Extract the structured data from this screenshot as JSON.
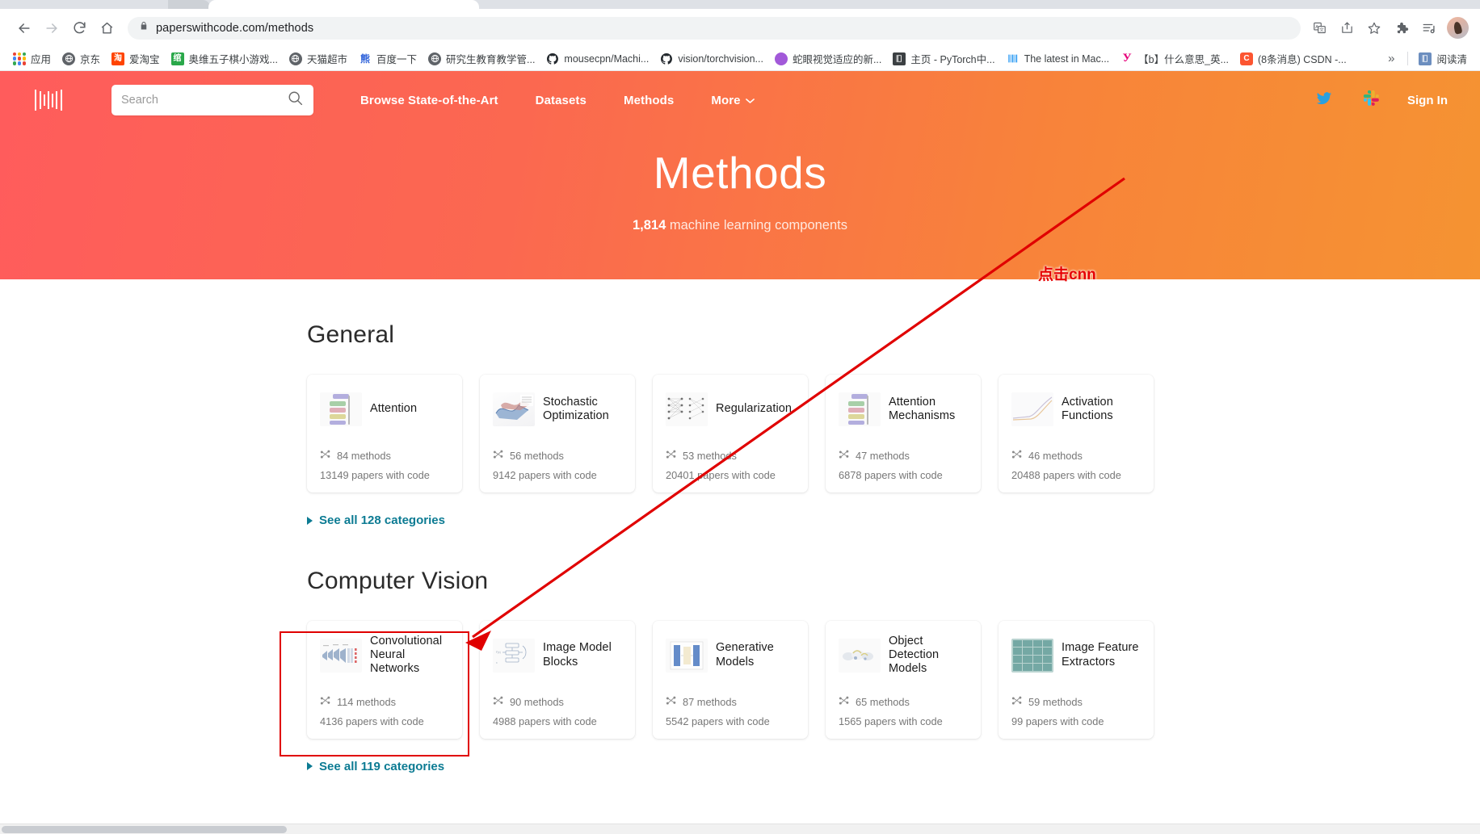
{
  "browser": {
    "url": "paperswithcode.com/methods",
    "nav": {
      "back": "Back",
      "forward": "Forward",
      "reload": "Reload",
      "home": "Home"
    },
    "toolbar_icons": [
      "translate-icon",
      "share-icon",
      "bookmark-star-icon",
      "extensions-puzzle-icon",
      "reading-list-icon",
      "profile-avatar"
    ],
    "bookmarks": [
      {
        "label": "应用",
        "icon": "apps-grid-icon",
        "color": "#4285f4"
      },
      {
        "label": "京东",
        "icon": "globe-icon",
        "color": "#5f6368"
      },
      {
        "label": "爱淘宝",
        "icon": "taobao-icon",
        "color": "#ff4400"
      },
      {
        "label": "奥维五子棋小游戏...",
        "icon": "game-icon",
        "color": "#2aa84a"
      },
      {
        "label": "天猫超市",
        "icon": "globe-icon",
        "color": "#5f6368"
      },
      {
        "label": "百度一下",
        "icon": "baidu-icon",
        "color": "#2b5fd9"
      },
      {
        "label": "研究生教育教学管...",
        "icon": "globe-icon",
        "color": "#5f6368"
      },
      {
        "label": "mousecpn/Machi...",
        "icon": "github-icon",
        "color": "#24292e"
      },
      {
        "label": "vision/torchvision...",
        "icon": "github-icon",
        "color": "#24292e"
      },
      {
        "label": "蛇眼视觉适应的新...",
        "icon": "purple-circle-icon",
        "color": "#a259d9"
      },
      {
        "label": "主页 - PyTorch中...",
        "icon": "book-icon",
        "color": "#3c4043"
      },
      {
        "label": "The latest in Mac...",
        "icon": "barcode-icon",
        "color": "#2196f3"
      },
      {
        "label": "【b】什么意思_英...",
        "icon": "yandex-y-icon",
        "color": "#e6007a"
      },
      {
        "label": "(8条消息) CSDN -...",
        "icon": "csdn-c-icon",
        "color": "#fc5531"
      }
    ],
    "bookmarks_overflow": "»",
    "reading_mode_label": "阅读清"
  },
  "site": {
    "logo": "paperswithcode-logo",
    "search": {
      "placeholder": "Search",
      "value": ""
    },
    "nav_links": [
      {
        "label": "Browse State-of-the-Art",
        "name": "nav-browse-sota"
      },
      {
        "label": "Datasets",
        "name": "nav-datasets"
      },
      {
        "label": "Methods",
        "name": "nav-methods"
      },
      {
        "label": "More",
        "name": "nav-more",
        "has_caret": true
      }
    ],
    "right": {
      "twitter": "twitter-icon",
      "slack": "slack-icon",
      "sign_in": "Sign In"
    },
    "hero": {
      "title": "Methods",
      "subtitle_count": "1,814",
      "subtitle_rest": " machine learning components"
    }
  },
  "sections": [
    {
      "name": "general",
      "heading": "General",
      "see_all": "See all 128 categories",
      "cards": [
        {
          "title": "Attention",
          "methods": "84 methods",
          "papers": "13149 papers with code",
          "thumb": "attention-diagram"
        },
        {
          "title": "Stochastic Optimization",
          "methods": "56 methods",
          "papers": "9142 papers with code",
          "thumb": "loss-surface-plot"
        },
        {
          "title": "Regularization",
          "methods": "53 methods",
          "papers": "20401 papers with code",
          "thumb": "dropout-network-diagram"
        },
        {
          "title": "Attention Mechanisms",
          "methods": "47 methods",
          "papers": "6878 papers with code",
          "thumb": "attention-diagram"
        },
        {
          "title": "Activation Functions",
          "methods": "46 methods",
          "papers": "20488 papers with code",
          "thumb": "activation-curve-plot"
        }
      ]
    },
    {
      "name": "computer-vision",
      "heading": "Computer Vision",
      "see_all": "See all 119 categories",
      "cards": [
        {
          "title": "Convolutional Neural Networks",
          "methods": "114 methods",
          "papers": "4136 papers with code",
          "thumb": "cnn-architecture-diagram"
        },
        {
          "title": "Image Model Blocks",
          "methods": "90 methods",
          "papers": "4988 papers with code",
          "thumb": "block-diagram"
        },
        {
          "title": "Generative Models",
          "methods": "87 methods",
          "papers": "5542 papers with code",
          "thumb": "gan-diagram"
        },
        {
          "title": "Object Detection Models",
          "methods": "65 methods",
          "papers": "1565 papers with code",
          "thumb": "detection-feature-map"
        },
        {
          "title": "Image Feature Extractors",
          "methods": "59 methods",
          "papers": "99 papers with code",
          "thumb": "feature-grid"
        }
      ]
    }
  ],
  "annotation": {
    "text": "点击cnn",
    "color": "#e60000",
    "arrow": "red-arrow-pointing-to-cnn-card",
    "highlight": "red-box-around-cnn-card"
  }
}
